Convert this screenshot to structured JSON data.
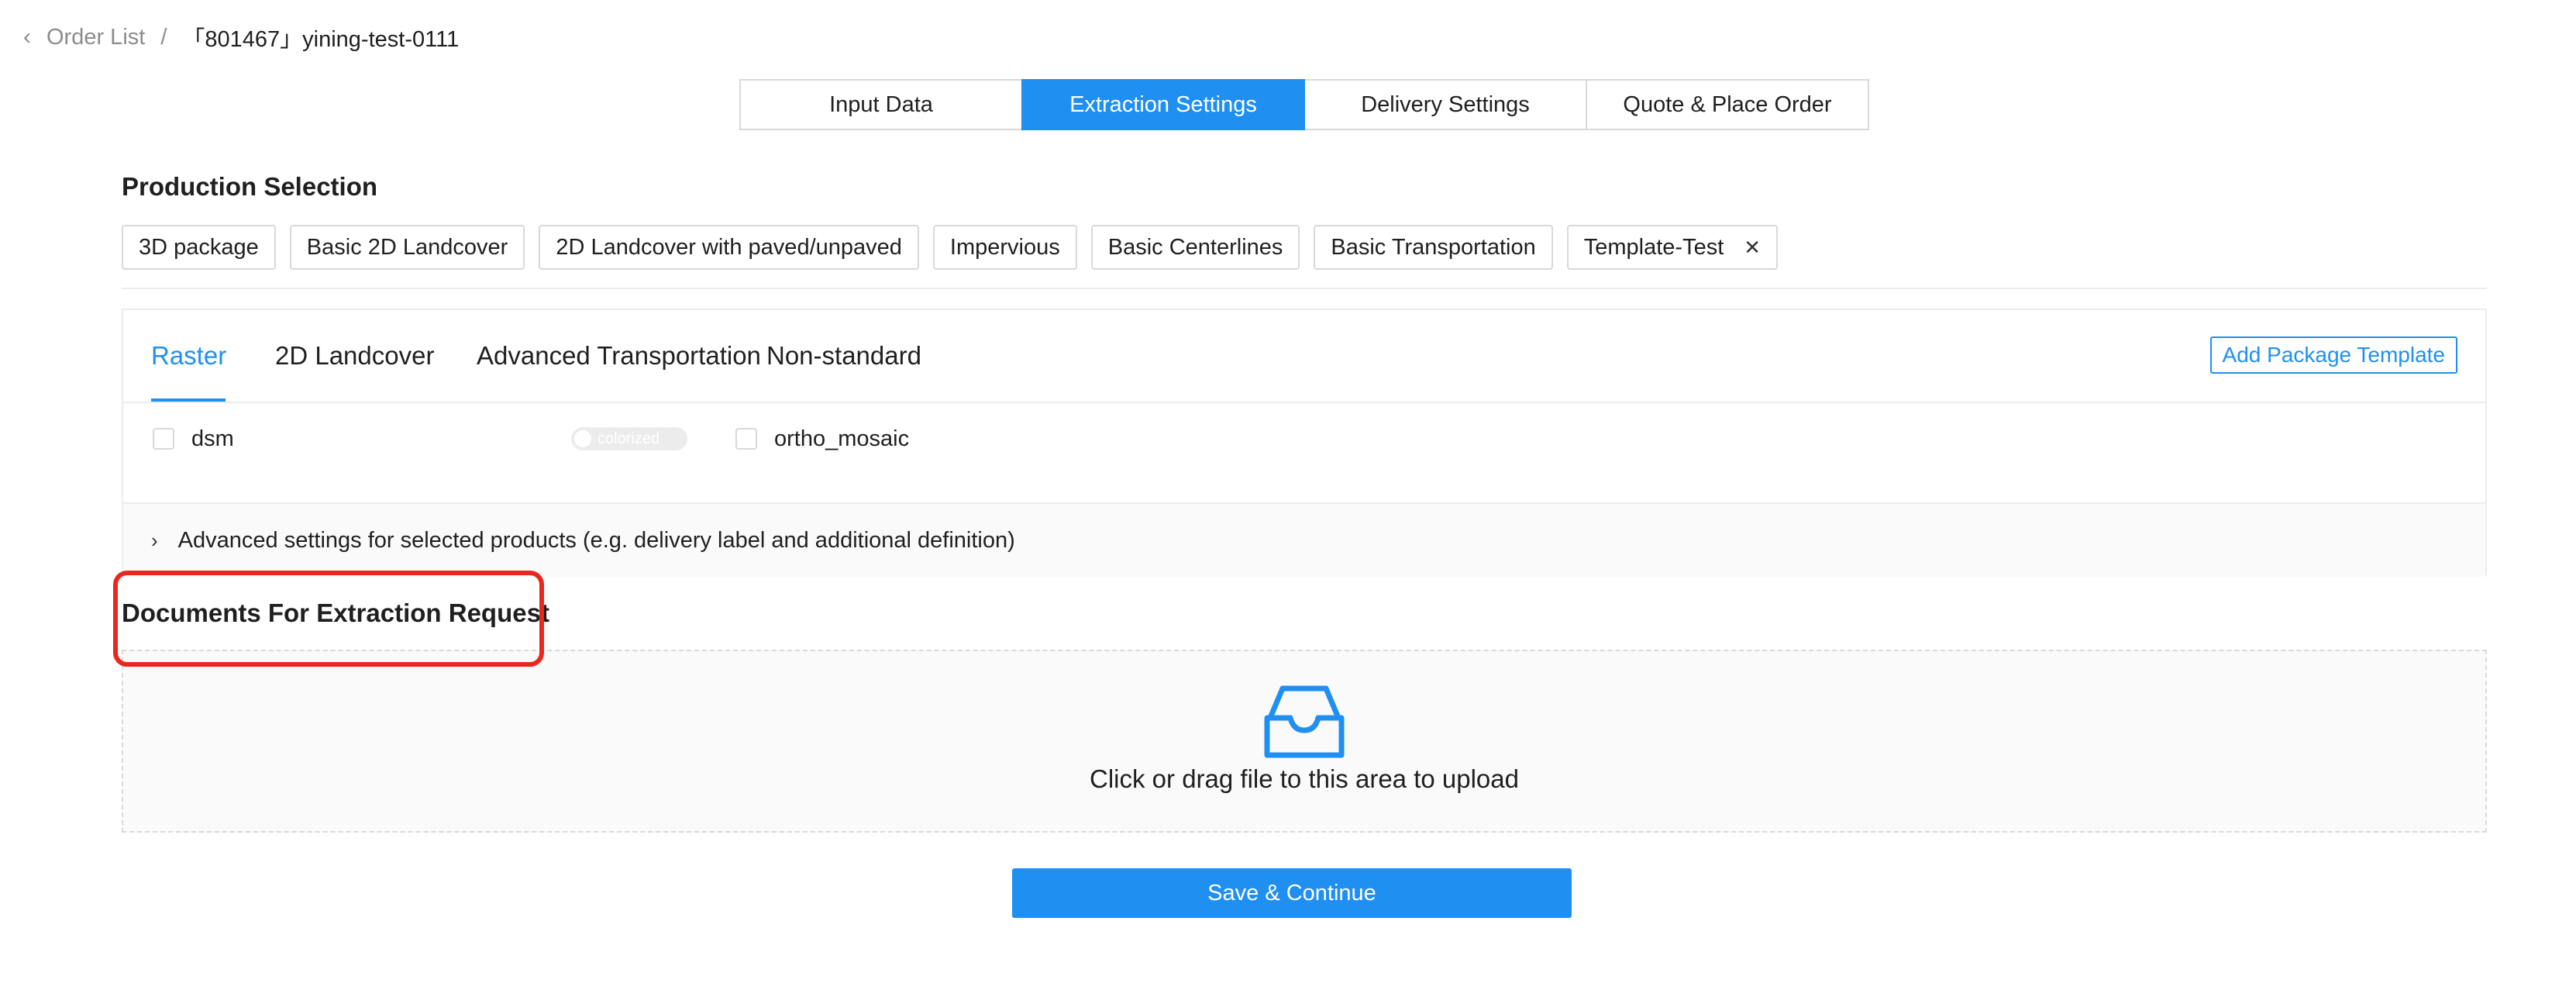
{
  "breadcrumb": {
    "back_icon": "chevron-left-icon",
    "parent": "Order List",
    "separator": "/",
    "current": "「801467」yining-test-0111"
  },
  "steps": [
    "Input Data",
    "Extraction Settings",
    "Delivery Settings",
    "Quote & Place Order"
  ],
  "active_step": "Extraction Settings",
  "production_selection": {
    "title": "Production Selection",
    "tags": [
      "3D package",
      "Basic 2D Landcover",
      "2D Landcover with paved/unpaved",
      "Impervious",
      "Basic Centerlines",
      "Basic Transportation",
      "Template-Test"
    ],
    "closable_tag_icon": "close-icon"
  },
  "product_tabs": {
    "items": [
      "Raster",
      "2D Landcover",
      "Advanced Transportation",
      "Non-standard"
    ],
    "active": "Raster",
    "add_template_label": "Add Package Template"
  },
  "raster_options": {
    "dsm_label": "dsm",
    "colorized_label": "colorized",
    "ortho_label": "ortho_mosaic"
  },
  "advanced_settings_label": "Advanced settings for selected products (e.g. delivery label and additional definition)",
  "documents": {
    "title": "Documents For Extraction Request",
    "upload_text": "Click or drag file to this area to upload",
    "icon": "inbox-icon"
  },
  "save_button": "Save & Continue",
  "colors": {
    "primary": "#1f8ff2",
    "highlight": "#e9271d",
    "border": "#d9d9d9"
  }
}
